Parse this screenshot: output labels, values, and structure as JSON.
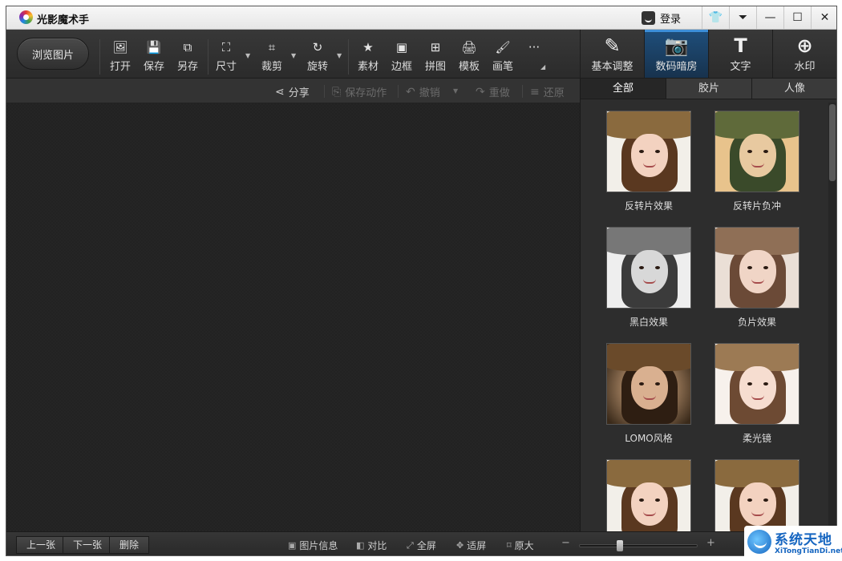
{
  "app": {
    "title": "光影魔术手",
    "login_label": "登录"
  },
  "titlebar_buttons": [
    {
      "name": "skin-button",
      "glyph": "👕"
    },
    {
      "name": "menu-button",
      "glyph": "⏷"
    },
    {
      "name": "minimize-button",
      "glyph": "—"
    },
    {
      "name": "maximize-button",
      "glyph": "☐"
    },
    {
      "name": "close-button",
      "glyph": "✕"
    }
  ],
  "toolbar": {
    "browse_label": "浏览图片",
    "tools": [
      {
        "label": "打开",
        "icon": "open-image-icon",
        "glyph": "🖼"
      },
      {
        "label": "保存",
        "icon": "save-icon",
        "glyph": "💾"
      },
      {
        "label": "另存",
        "icon": "save-as-icon",
        "glyph": "⧉"
      },
      {
        "label": "尺寸",
        "icon": "resize-icon",
        "glyph": "⛶"
      },
      {
        "label": "裁剪",
        "icon": "crop-icon",
        "glyph": "⌗"
      },
      {
        "label": "旋转",
        "icon": "rotate-icon",
        "glyph": "↻"
      },
      {
        "label": "素材",
        "icon": "material-icon",
        "glyph": "★"
      },
      {
        "label": "边框",
        "icon": "border-icon",
        "glyph": "▣"
      },
      {
        "label": "拼图",
        "icon": "collage-icon",
        "glyph": "⊞"
      },
      {
        "label": "模板",
        "icon": "template-icon",
        "glyph": "🖨"
      },
      {
        "label": "画笔",
        "icon": "brush-icon",
        "glyph": "🖌"
      },
      {
        "label": "",
        "icon": "more-icon",
        "glyph": "···"
      }
    ]
  },
  "mode_tabs": [
    {
      "label": "基本调整",
      "icon": "basic-adjust-icon",
      "glyph": "✎",
      "active": false
    },
    {
      "label": "数码暗房",
      "icon": "darkroom-camera-icon",
      "glyph": "📷",
      "active": true
    },
    {
      "label": "文字",
      "icon": "text-icon",
      "glyph": "T",
      "active": false
    },
    {
      "label": "水印",
      "icon": "watermark-icon",
      "glyph": "⊕",
      "active": false
    }
  ],
  "actions": [
    {
      "label": "分享",
      "icon": "share-icon",
      "glyph": "⋖",
      "enabled": true
    },
    {
      "label": "保存动作",
      "icon": "save-action-icon",
      "glyph": "⎘",
      "enabled": false
    },
    {
      "label": "撤销",
      "icon": "undo-icon",
      "glyph": "↶",
      "enabled": false
    },
    {
      "label": "重做",
      "icon": "redo-icon",
      "glyph": "↷",
      "enabled": false
    },
    {
      "label": "还原",
      "icon": "restore-icon",
      "glyph": "≡",
      "enabled": false
    }
  ],
  "panel": {
    "tabs": [
      {
        "label": "全部",
        "active": true
      },
      {
        "label": "胶片",
        "active": false
      },
      {
        "label": "人像",
        "active": false
      }
    ],
    "effects": [
      {
        "label": "反转片效果",
        "style": "vivid"
      },
      {
        "label": "反转片负冲",
        "style": "cross"
      },
      {
        "label": "黑白效果",
        "style": "bw"
      },
      {
        "label": "负片效果",
        "style": "neg"
      },
      {
        "label": "LOMO风格",
        "style": "lomo"
      },
      {
        "label": "柔光镜",
        "style": "soft"
      },
      {
        "label": "",
        "style": "vivid"
      },
      {
        "label": "",
        "style": "vivid"
      }
    ]
  },
  "statusbar": {
    "prev_label": "上一张",
    "next_label": "下一张",
    "delete_label": "删除",
    "tools": [
      {
        "label": "图片信息",
        "icon": "image-info-icon",
        "glyph": "▣"
      },
      {
        "label": "对比",
        "icon": "compare-icon",
        "glyph": "◧"
      },
      {
        "label": "全屏",
        "icon": "fullscreen-icon",
        "glyph": "⤢"
      },
      {
        "label": "适屏",
        "icon": "fit-screen-icon",
        "glyph": "✥"
      },
      {
        "label": "原大",
        "icon": "actual-size-icon",
        "glyph": "⌑"
      }
    ],
    "zoom_level": 0.33
  },
  "watermark": {
    "title": "系统天地",
    "url": "XiTongTianDi.net"
  },
  "colors": {
    "accent": "#3d8fd8",
    "active_tab": "#1f4f7c",
    "background": "#2a2a2a"
  }
}
